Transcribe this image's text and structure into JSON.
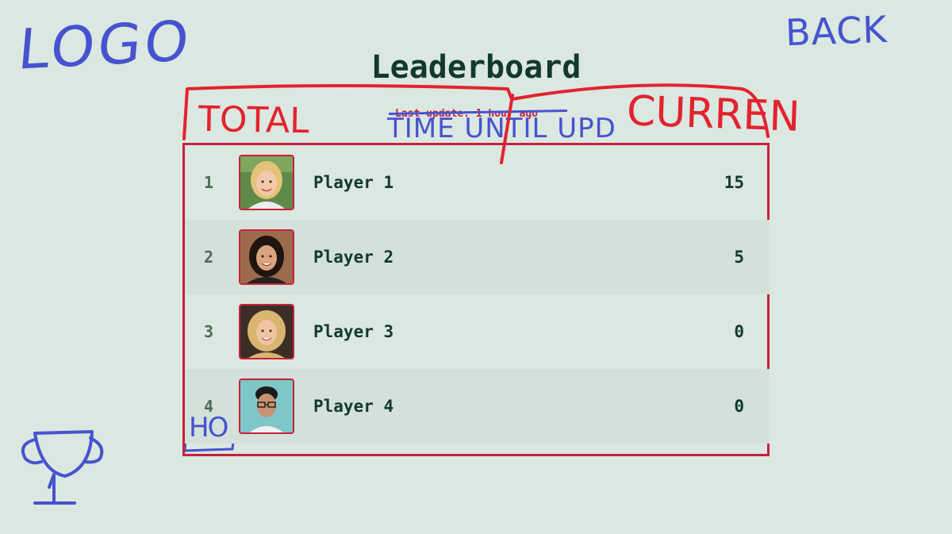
{
  "annotations": {
    "logo": "LOGO",
    "back": "BACK",
    "total": "TOTAL",
    "time_until": "TIME UNTIL UPD",
    "current": "CURREN",
    "rank_note": "HO"
  },
  "header": {
    "title": "Leaderboard",
    "last_update": "Last update: 1 hour ago"
  },
  "leaderboard": {
    "rows": [
      {
        "rank": "1",
        "name": "Player 1",
        "score": "15",
        "avatar": "avatar-blonde-woman"
      },
      {
        "rank": "2",
        "name": "Player 2",
        "score": "5",
        "avatar": "avatar-dark-hair-woman"
      },
      {
        "rank": "3",
        "name": "Player 3",
        "score": "0",
        "avatar": "avatar-blonde-curly-woman"
      },
      {
        "rank": "4",
        "name": "Player 4",
        "score": "0",
        "avatar": "avatar-glasses-person"
      }
    ]
  },
  "icons": {
    "trophy": "trophy-icon"
  },
  "colors": {
    "background": "#dbe7e1",
    "row_alt": "#d3e1da",
    "accent_red": "#c8203a",
    "sketch_blue": "#4653cf",
    "sketch_red": "#e2232e",
    "text_dark": "#123a2c"
  }
}
